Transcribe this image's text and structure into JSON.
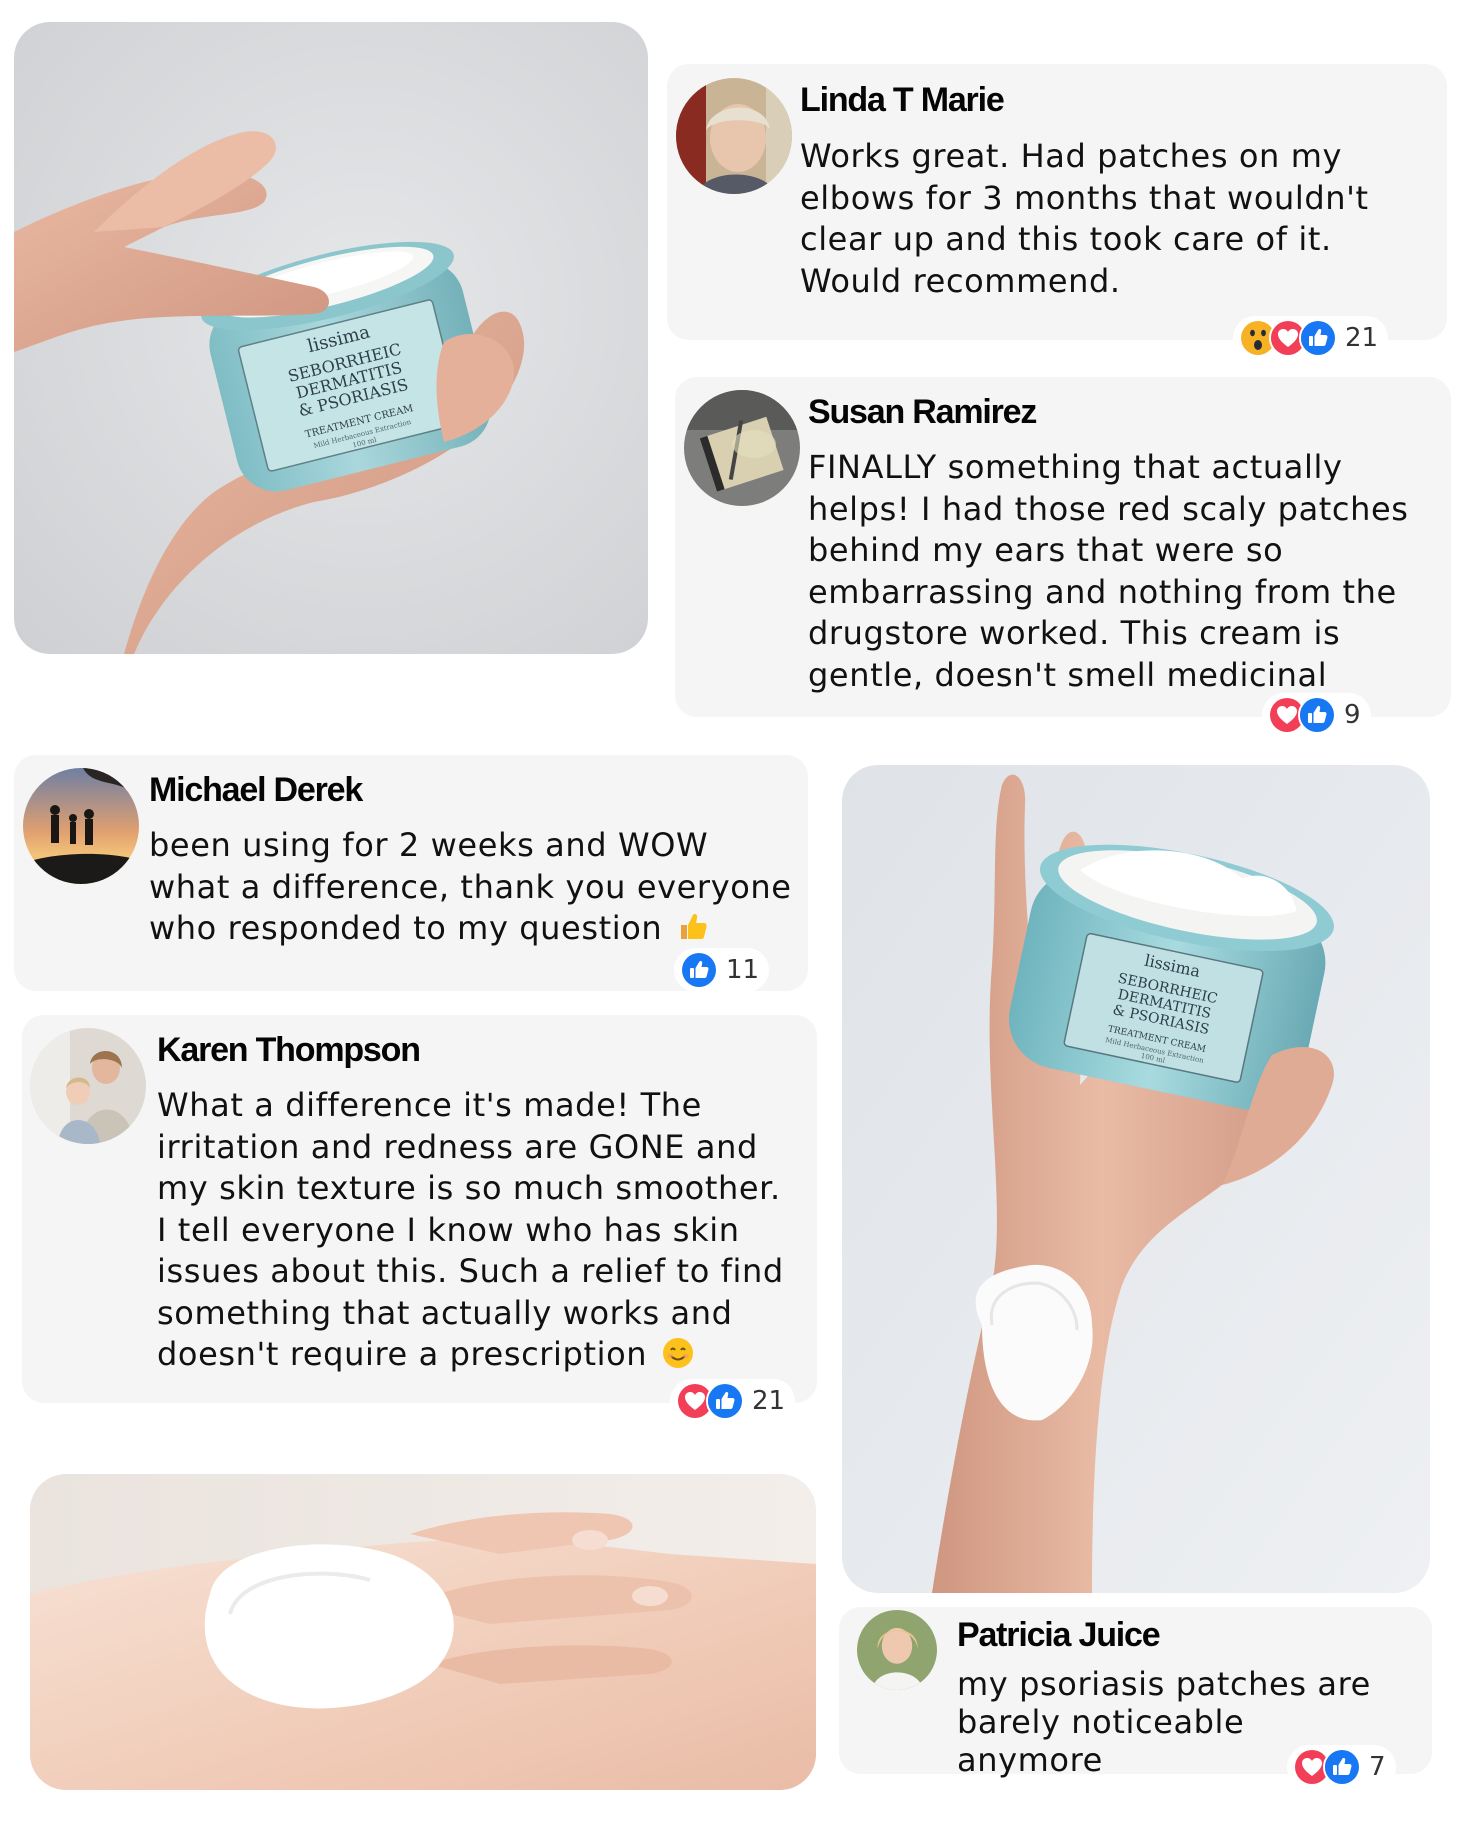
{
  "reviews": [
    {
      "name": "Linda T Marie",
      "text": "Works great. Had patches on my elbows for 3 months that wouldn't clear up and this took care of it. Would recommend.",
      "reaction_count": "21",
      "reactions": [
        "wow",
        "love",
        "like"
      ]
    },
    {
      "name": "Susan Ramirez",
      "text": "FINALLY something that actually helps! I had those red scaly patches behind my ears that were so embarrassing and nothing from the drugstore worked. This cream is gentle, doesn't smell medicinal",
      "reaction_count": "9",
      "reactions": [
        "love",
        "like"
      ]
    },
    {
      "name": "Michael Derek",
      "text": "been using for 2 weeks and WOW what a difference, thank you everyone who responded to my question",
      "emoji": "thumbs-up-emoji",
      "reaction_count": "11",
      "reactions": [
        "like"
      ]
    },
    {
      "name": "Karen Thompson",
      "text": "What a difference it's made! The irritation and redness are GONE and my skin texture is so much smoother. I tell everyone I know who has skin issues about this. Such a relief to find something that actually works and doesn't require a prescription",
      "emoji": "smiling-face-emoji",
      "reaction_count": "21",
      "reactions": [
        "love",
        "like"
      ]
    },
    {
      "name": "Patricia Juice",
      "text": "my psoriasis patches are barely noticeable anymore",
      "reaction_count": "7",
      "reactions": [
        "love",
        "like"
      ]
    }
  ],
  "product_label": {
    "brand": "lissima",
    "line1": "SEBORRHEIC",
    "line2": "DERMATITIS",
    "line3": "& PSORIASIS",
    "line4": "TREATMENT CREAM",
    "line5": "Mild Herbaceous Extraction",
    "line6": "100 ml"
  },
  "colors": {
    "card_bg": "#f5f5f6",
    "like_blue": "#1877f2",
    "love_red": "#f33e58",
    "wow_yellow": "#f7b125",
    "jar_teal": "#9cd0d6"
  }
}
